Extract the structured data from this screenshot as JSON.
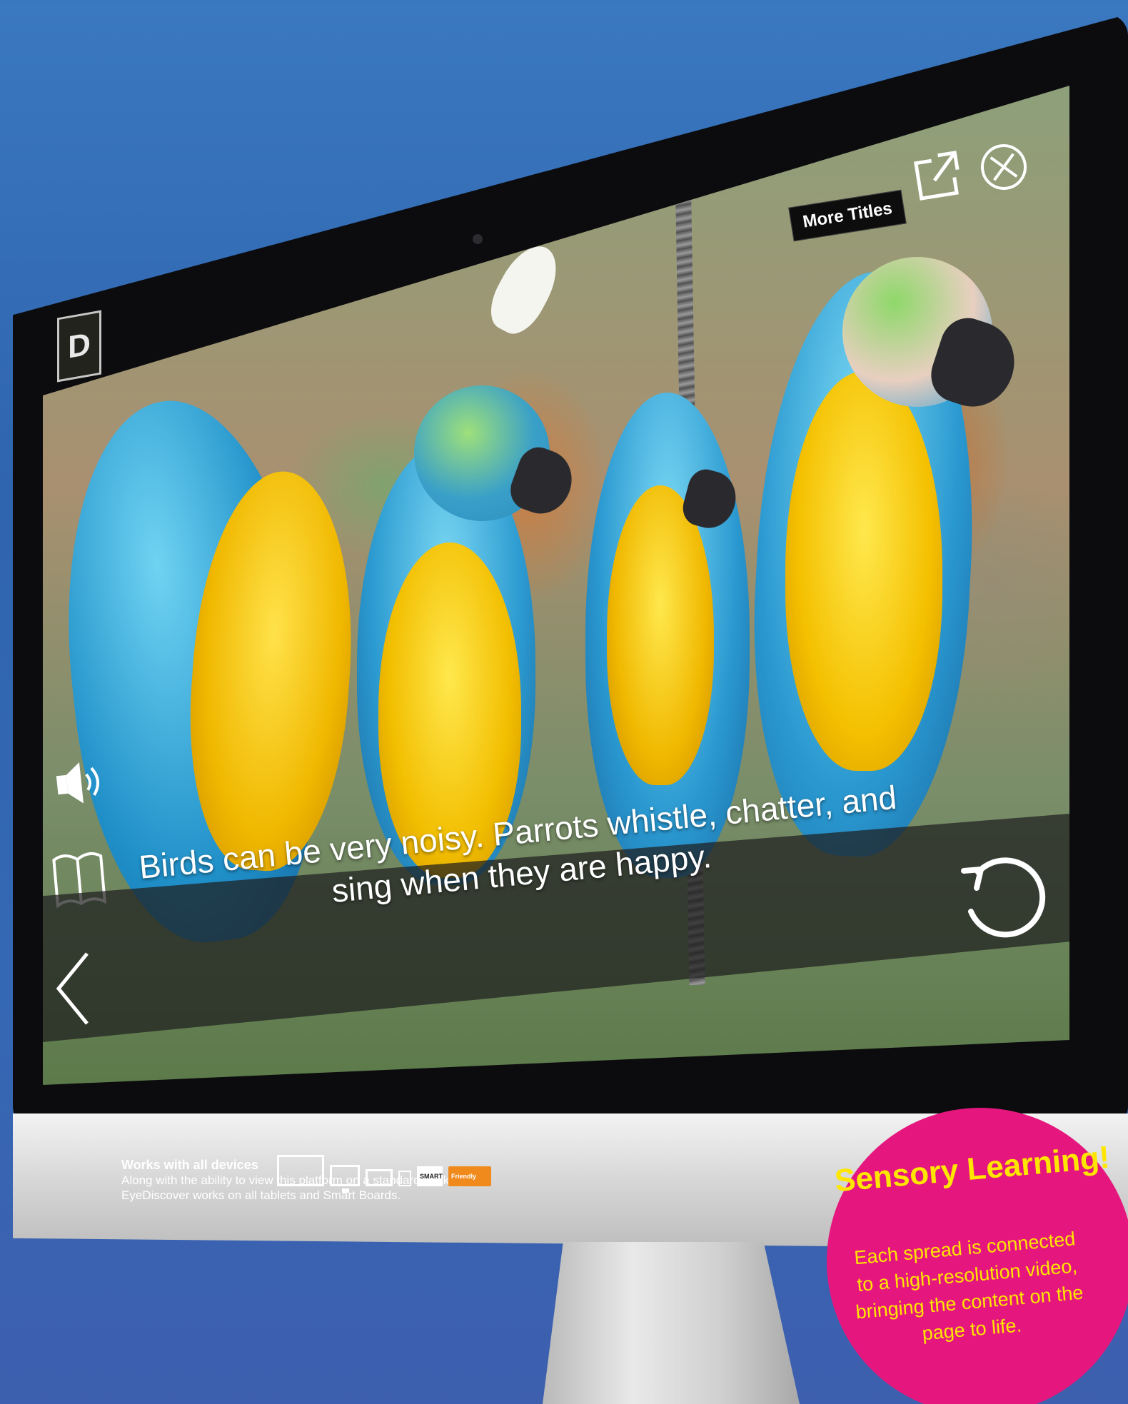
{
  "screen": {
    "app_logo_text": "D",
    "more_titles_label": "More Titles",
    "caption": "Birds can be very noisy. Parrots whistle, chatter, and sing when they are happy.",
    "icons": {
      "export": "export-icon",
      "close": "close-icon",
      "speaker": "speaker-icon",
      "book": "book-icon",
      "back": "chevron-left-icon",
      "replay": "replay-icon"
    }
  },
  "devices": {
    "title": "Works with all devices",
    "body": "Along with the ability to view this platform on a standard desktop, EyeDiscover works on all tablets and Smart Boards.",
    "badge_smart": "SMART",
    "badge_friendly": "Friendly"
  },
  "sensory": {
    "title": "Sensory Learning!",
    "body": "Each spread is connected to a high-resolution video, bringing the content on the page to life."
  },
  "colors": {
    "background": "#2f64ae",
    "circle": "#e5177f",
    "circle_text": "#ffe600"
  }
}
